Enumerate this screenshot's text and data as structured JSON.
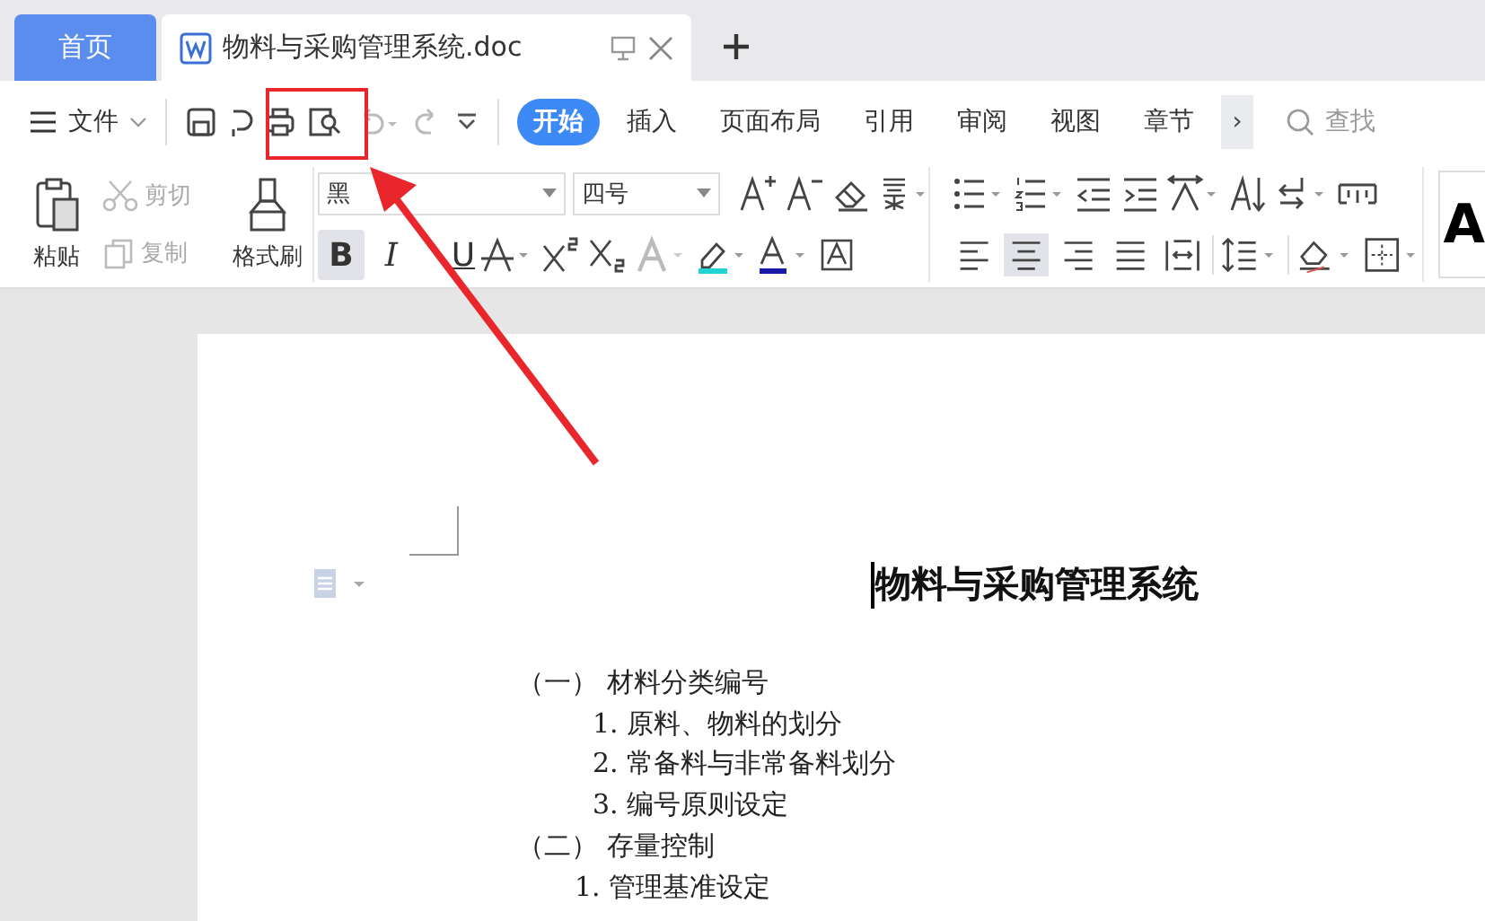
{
  "tabs": [
    {
      "label": "首页",
      "kind": "home",
      "selected": false
    },
    {
      "label": "物料与采购管理系统.doc",
      "kind": "doc",
      "selected": true
    }
  ],
  "quick_bar": {
    "file_menu": "文件",
    "menu_tabs": [
      {
        "label": "开始",
        "selected": true
      },
      {
        "label": "插入",
        "selected": false
      },
      {
        "label": "页面布局",
        "selected": false
      },
      {
        "label": "引用",
        "selected": false
      },
      {
        "label": "审阅",
        "selected": false
      },
      {
        "label": "视图",
        "selected": false
      },
      {
        "label": "章节",
        "selected": false
      }
    ],
    "more": "›",
    "search_placeholder": "查找"
  },
  "ribbon": {
    "clipboard": [
      {
        "label": "粘贴",
        "kind": "paste",
        "disabled": false
      },
      {
        "label": "剪切",
        "kind": "cut",
        "disabled": true
      },
      {
        "label": "复制",
        "kind": "copy",
        "disabled": true
      },
      {
        "label": "格式刷",
        "kind": "painter",
        "disabled": false
      }
    ],
    "font_name": "黑",
    "font_size": "四号",
    "font_buttons": [
      {
        "label": "B",
        "on": true
      },
      {
        "label": "I",
        "on": false
      },
      {
        "label": "U",
        "on": false
      }
    ],
    "paragraph_align": [
      {
        "kind": "left",
        "selected": false
      },
      {
        "kind": "center",
        "selected": true
      },
      {
        "kind": "right",
        "selected": false
      },
      {
        "kind": "justify",
        "selected": false
      },
      {
        "kind": "distributed",
        "selected": false
      }
    ],
    "style_preview": "A"
  },
  "document": {
    "title": "物料与采购管理系统",
    "outline": [
      {
        "text": "（一） 材料分类编号",
        "children": [
          {
            "text": "1. 原料、物料的划分"
          },
          {
            "text": "2. 常备料与非常备料划分"
          },
          {
            "text": "3. 编号原则设定"
          }
        ]
      },
      {
        "text": "（二） 存量控制",
        "children": [
          {
            "text": "1. 管理基准设定"
          }
        ]
      }
    ]
  }
}
